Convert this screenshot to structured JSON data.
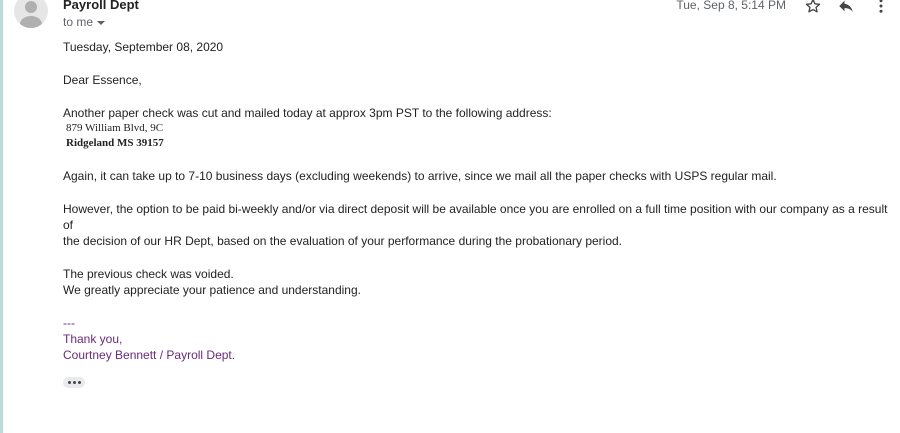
{
  "email": {
    "sender": "Payroll Dept",
    "recipient_label": "to me",
    "timestamp": "Tue, Sep 8, 5:14 PM",
    "body": {
      "date_line": "Tuesday, September 08, 2020",
      "greeting": "Dear Essence,",
      "para1": "Another paper check was cut and mailed today at approx 3pm PST to the following address:",
      "address_line1": "879 William Blvd, 9C",
      "address_line2": "Ridgeland MS 39157",
      "para2": "Again, it can take up to 7-10 business days (excluding weekends) to arrive, since we mail all the paper checks with USPS regular mail.",
      "para3_line1": "However, the option to be paid bi-weekly and/or via direct deposit will be available once you are enrolled on a full time position with our company as a result of",
      "para3_line2": "the decision of our HR Dept, based on the evaluation of your performance during the probationary period.",
      "para4_line1": "The previous check was voided.",
      "para4_line2": "We greatly appreciate your patience and understanding.",
      "sig_sep": "---",
      "sig_thanks": "Thank you,",
      "sig_name": "Courtney Bennett / Payroll Dept."
    }
  },
  "icons": {
    "avatar": "avatar-icon",
    "star": "star-icon",
    "reply": "reply-icon",
    "more": "more-vert-icon",
    "dropdown": "chevron-down-icon",
    "ellipsis": "show-trimmed-content-icon"
  },
  "colors": {
    "signature": "#6a2a7a",
    "meta": "#5f6368",
    "accent": "#b7ddd8"
  }
}
